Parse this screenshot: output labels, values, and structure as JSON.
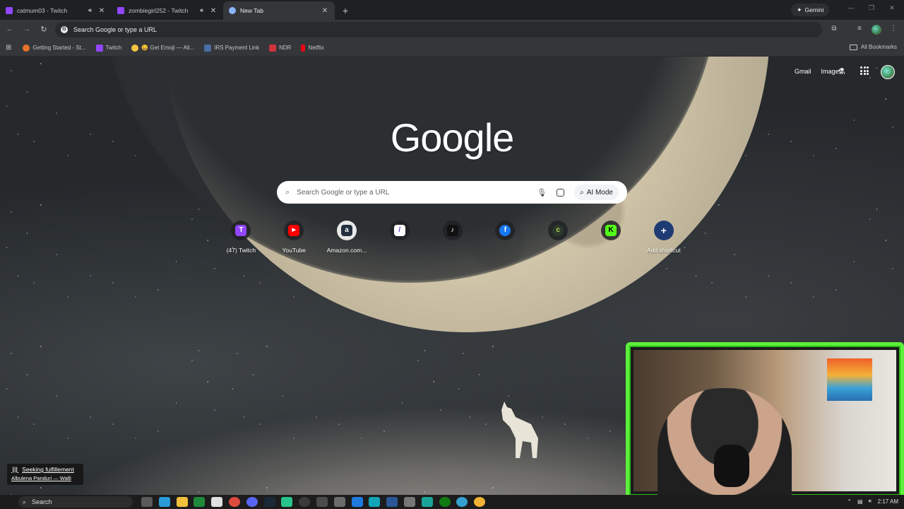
{
  "tabs": [
    {
      "title": "catmum03 - Twitch",
      "favicon_color": "#9146ff",
      "audio": true,
      "active": false
    },
    {
      "title": "zombiegirl252 - Twitch",
      "favicon_color": "#9146ff",
      "audio": true,
      "active": false
    },
    {
      "title": "New Tab",
      "favicon_color": "#8ab4f8",
      "audio": false,
      "active": true
    }
  ],
  "gemini_label": "Gemini",
  "omnibox": {
    "placeholder": "Search Google or type a URL"
  },
  "bookmarks": [
    {
      "label": "Getting Started - St...",
      "color": "#e8712b"
    },
    {
      "label": "Twitch",
      "color": "#9146ff"
    },
    {
      "label": "😀 Get Emoji — All...",
      "color": "#f4c542"
    },
    {
      "label": "IRS Payment Link",
      "color": "#4a6fa5"
    },
    {
      "label": "NDR",
      "color": "#d0343b"
    },
    {
      "label": "Netflix",
      "color": "#e50914"
    }
  ],
  "all_bookmarks_label": "All Bookmarks",
  "ntp": {
    "gmail": "Gmail",
    "images": "Images",
    "logo": "Google",
    "search_placeholder": "Search Google or type a URL",
    "ai_mode": "AI Mode"
  },
  "shortcuts": [
    {
      "label": "(47) Twitch",
      "glyph": "T",
      "color": "#9146ff"
    },
    {
      "label": "YouTube",
      "glyph": "▶",
      "color": "#ff0000"
    },
    {
      "label": "Amazon.com...",
      "glyph": "a",
      "color": "#232f3e"
    },
    {
      "label": "",
      "glyph": "/",
      "color": "#6f3bd3"
    },
    {
      "label": "",
      "glyph": "♪",
      "color": "#111111"
    },
    {
      "label": "",
      "glyph": "f",
      "color": "#1877f2"
    },
    {
      "label": "",
      "glyph": "c",
      "color": "#2b3a2b"
    },
    {
      "label": "",
      "glyph": "K",
      "color": "#53fc18"
    },
    {
      "label": "Add shortcut",
      "glyph": "+",
      "color": "#1f3b73"
    }
  ],
  "notification": {
    "line1": "Seeking fulfillement",
    "line2": "Albulena Panduri — Walli"
  },
  "taskbar": {
    "search": "Search",
    "time": "2:17 AM"
  }
}
